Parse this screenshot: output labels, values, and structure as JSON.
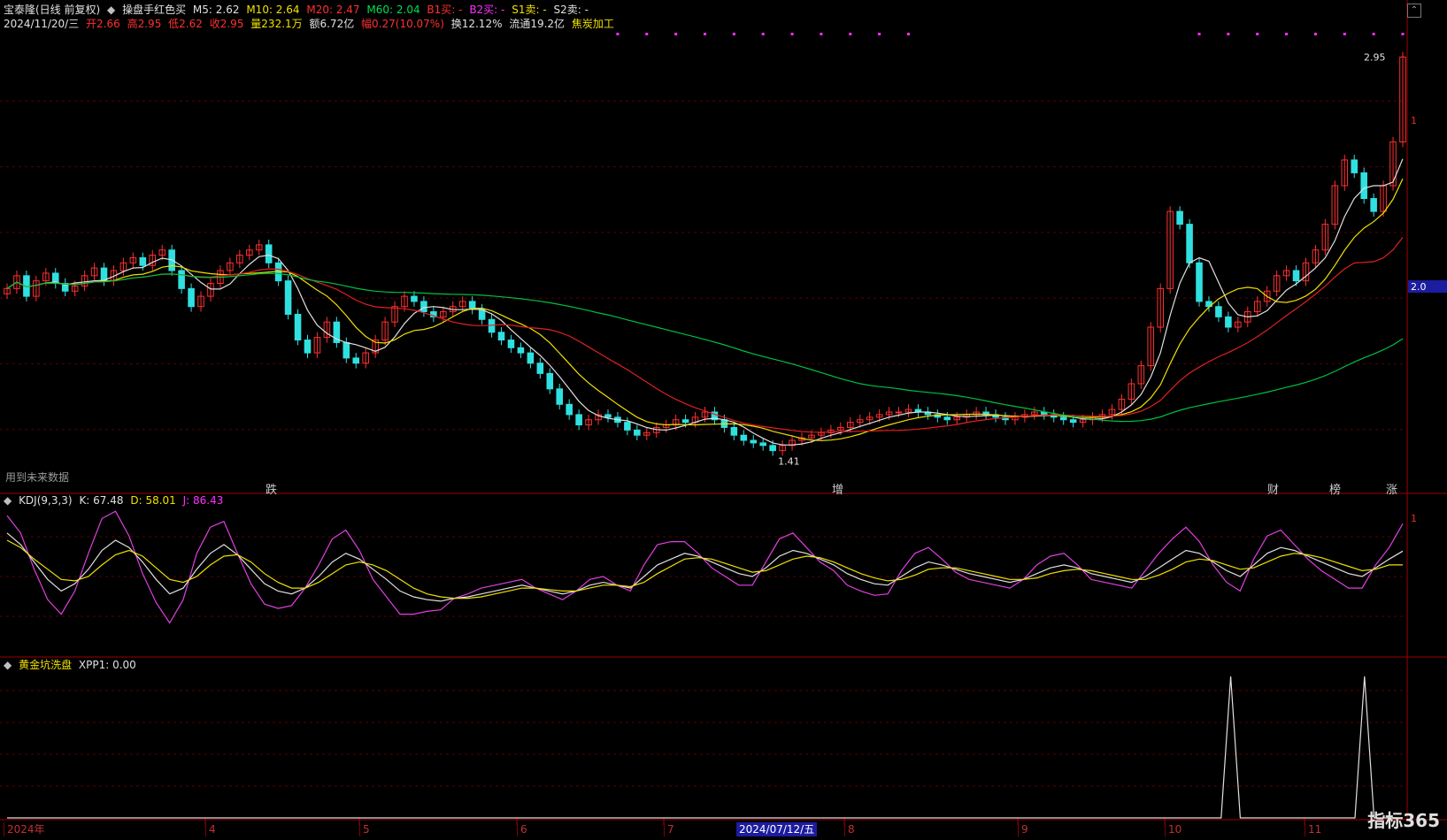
{
  "header": {
    "stock_name": "宝泰隆(日线 前复权)",
    "indicator_name": "操盘手红色买",
    "m5": "M5: 2.62",
    "m10": "M10: 2.64",
    "m20": "M20: 2.47",
    "m60": "M60: 2.04",
    "b1": "B1买: -",
    "b2": "B2买: -",
    "s1": "S1卖: -",
    "s2": "S2卖: -"
  },
  "quote": {
    "date": "2024/11/20/三",
    "open": "开2.66",
    "high": "高2.95",
    "low": "低2.62",
    "close": "收2.95",
    "volume": "量232.1万",
    "amount": "额6.72亿",
    "change": "幅0.27(10.07%)",
    "turnover": "换12.12%",
    "float_cap": "流通19.2亿",
    "sector": "焦炭加工"
  },
  "main_chart": {
    "future_data_note": "用到未来数据",
    "high_marker": "2.95",
    "low_marker": "1.41",
    "right_labels": [
      "1",
      "2.0"
    ],
    "events": [
      {
        "text": "跌",
        "color": "#30d030"
      },
      {
        "text": "增",
        "color": "#ff8080"
      },
      {
        "text": "财",
        "color": "#40a0ff"
      },
      {
        "text": "榜",
        "color": "#ff8040"
      },
      {
        "text": "涨",
        "color": "#ff4040"
      }
    ]
  },
  "kdj_panel": {
    "title": "KDJ(9,3,3)",
    "k": "K: 67.48",
    "d": "D: 58.01",
    "j": "J: 86.43",
    "right_label": "1"
  },
  "xpp_panel": {
    "title": "黄金坑洗盘",
    "value": "XPP1: 0.00"
  },
  "x_axis": {
    "labels": [
      "2024年",
      "4",
      "5",
      "6",
      "7",
      "2024/07/12/五",
      "8",
      "9",
      "10",
      "11"
    ]
  },
  "logo": "指标365",
  "colors": {
    "up": "#ff3030",
    "down": "#30e0e0",
    "ma5": "#e0e0e0",
    "ma10": "#f0e000",
    "ma20": "#e02020",
    "ma60": "#00c040",
    "k": "#e0e0e0",
    "d": "#f0e000",
    "j": "#e040e0"
  },
  "chart_data": [
    {
      "type": "candlestick",
      "title": "宝泰隆(日线 前复权)",
      "series_close": [
        2.05,
        2.1,
        2.02,
        2.08,
        2.11,
        2.07,
        2.04,
        2.06,
        2.1,
        2.13,
        2.08,
        2.12,
        2.15,
        2.17,
        2.14,
        2.18,
        2.2,
        2.12,
        2.05,
        1.98,
        2.02,
        2.07,
        2.12,
        2.15,
        2.18,
        2.2,
        2.22,
        2.15,
        2.08,
        1.95,
        1.85,
        1.8,
        1.86,
        1.92,
        1.84,
        1.78,
        1.76,
        1.8,
        1.85,
        1.92,
        1.98,
        2.02,
        2.0,
        1.96,
        1.94,
        1.96,
        1.98,
        2.0,
        1.97,
        1.93,
        1.88,
        1.85,
        1.82,
        1.8,
        1.76,
        1.72,
        1.66,
        1.6,
        1.56,
        1.52,
        1.54,
        1.56,
        1.55,
        1.53,
        1.5,
        1.48,
        1.49,
        1.51,
        1.52,
        1.54,
        1.53,
        1.55,
        1.57,
        1.54,
        1.51,
        1.48,
        1.46,
        1.45,
        1.44,
        1.42,
        1.44,
        1.46,
        1.47,
        1.48,
        1.49,
        1.5,
        1.51,
        1.53,
        1.54,
        1.55,
        1.56,
        1.57,
        1.57,
        1.58,
        1.57,
        1.56,
        1.55,
        1.54,
        1.55,
        1.56,
        1.57,
        1.56,
        1.55,
        1.54,
        1.55,
        1.56,
        1.57,
        1.56,
        1.55,
        1.54,
        1.53,
        1.54,
        1.55,
        1.56,
        1.58,
        1.62,
        1.68,
        1.75,
        1.9,
        2.05,
        2.35,
        2.3,
        2.15,
        2.0,
        1.98,
        1.94,
        1.9,
        1.92,
        1.96,
        2.0,
        2.04,
        2.1,
        2.12,
        2.08,
        2.15,
        2.2,
        2.3,
        2.45,
        2.55,
        2.5,
        2.4,
        2.35,
        2.45,
        2.62,
        2.95
      ]
    },
    {
      "type": "line",
      "title": "KDJ(9,3,3)",
      "series": [
        {
          "name": "K",
          "values": [
            80,
            72,
            60,
            48,
            40,
            45,
            55,
            68,
            75,
            70,
            60,
            48,
            38,
            42,
            55,
            66,
            72,
            65,
            55,
            45,
            40,
            38,
            42,
            50,
            60,
            66,
            62,
            55,
            48,
            40,
            36,
            34,
            33,
            35,
            36,
            38,
            40,
            42,
            44,
            42,
            40,
            38,
            40,
            44,
            46,
            44,
            42,
            50,
            58,
            62,
            66,
            64,
            60,
            56,
            52,
            50,
            56,
            64,
            68,
            66,
            62,
            58,
            52,
            48,
            45,
            44,
            50,
            56,
            60,
            58,
            55,
            52,
            50,
            48,
            46,
            48,
            52,
            56,
            58,
            56,
            52,
            50,
            48,
            46,
            50,
            56,
            62,
            68,
            66,
            60,
            54,
            50,
            58,
            66,
            70,
            68,
            64,
            60,
            56,
            52,
            50,
            56,
            62,
            67.48
          ]
        },
        {
          "name": "D",
          "values": [
            75,
            70,
            62,
            55,
            48,
            47,
            50,
            58,
            65,
            68,
            64,
            56,
            48,
            46,
            50,
            58,
            64,
            65,
            60,
            52,
            46,
            42,
            42,
            46,
            52,
            58,
            60,
            58,
            54,
            48,
            42,
            38,
            36,
            35,
            35,
            36,
            38,
            40,
            42,
            42,
            41,
            40,
            40,
            42,
            44,
            44,
            43,
            46,
            52,
            57,
            62,
            63,
            62,
            59,
            56,
            53,
            54,
            58,
            62,
            64,
            63,
            60,
            56,
            52,
            49,
            47,
            48,
            51,
            55,
            56,
            56,
            54,
            52,
            50,
            48,
            48,
            49,
            52,
            54,
            55,
            54,
            52,
            50,
            48,
            48,
            51,
            55,
            60,
            62,
            61,
            58,
            55,
            56,
            60,
            64,
            66,
            65,
            63,
            60,
            57,
            54,
            55,
            58,
            58.01
          ]
        },
        {
          "name": "J",
          "values": [
            92,
            80,
            55,
            34,
            24,
            40,
            66,
            90,
            95,
            78,
            52,
            32,
            18,
            34,
            66,
            84,
            88,
            66,
            45,
            31,
            28,
            30,
            42,
            58,
            76,
            82,
            68,
            48,
            36,
            24,
            24,
            26,
            27,
            35,
            38,
            42,
            44,
            46,
            48,
            42,
            38,
            34,
            40,
            48,
            50,
            44,
            40,
            58,
            72,
            74,
            74,
            66,
            56,
            50,
            44,
            44,
            60,
            76,
            80,
            70,
            60,
            54,
            44,
            40,
            37,
            38,
            54,
            66,
            70,
            62,
            53,
            48,
            46,
            44,
            42,
            48,
            58,
            64,
            66,
            58,
            48,
            46,
            44,
            42,
            54,
            66,
            76,
            84,
            74,
            58,
            46,
            40,
            62,
            78,
            82,
            72,
            62,
            54,
            48,
            42,
            42,
            58,
            70,
            86.43
          ]
        }
      ]
    },
    {
      "type": "line",
      "title": "黄金坑洗盘",
      "series": [
        {
          "name": "XPP1",
          "values": [
            0,
            0,
            0,
            0,
            0,
            0,
            0,
            0,
            0,
            0,
            0,
            0,
            0,
            0,
            0,
            0,
            0,
            0,
            0,
            0,
            0,
            0,
            0,
            0,
            0,
            0,
            0,
            0,
            0,
            0,
            0,
            0,
            0,
            0,
            0,
            0,
            0,
            0,
            0,
            0,
            0,
            0,
            0,
            0,
            0,
            0,
            0,
            0,
            0,
            0,
            0,
            0,
            0,
            0,
            0,
            0,
            0,
            0,
            0,
            0,
            0,
            0,
            0,
            0,
            0,
            0,
            0,
            0,
            0,
            0,
            0,
            0,
            0,
            0,
            0,
            0,
            0,
            0,
            0,
            0,
            0,
            0,
            0,
            0,
            0,
            0,
            0,
            0,
            0,
            0,
            0,
            0,
            0,
            0,
            0,
            0,
            0,
            0,
            0,
            0,
            0,
            0,
            0,
            0,
            0,
            0,
            0,
            0,
            0,
            0,
            0,
            0,
            0,
            0,
            0,
            0,
            0,
            0,
            0,
            0,
            0,
            0,
            0,
            0,
            0,
            0,
            0,
            0,
            1,
            0,
            0,
            0,
            0,
            0,
            0,
            0,
            0,
            0,
            0,
            0,
            0,
            0,
            1,
            0,
            0,
            0,
            0.0
          ]
        }
      ]
    }
  ]
}
